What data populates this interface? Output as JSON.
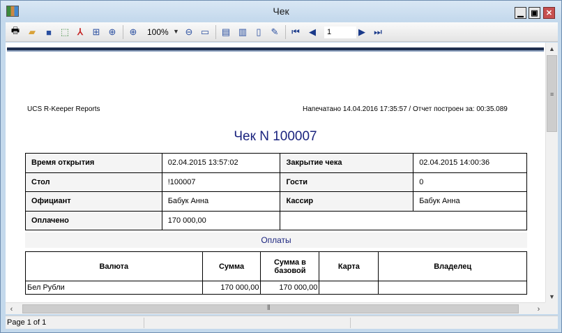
{
  "window": {
    "title": "Чек"
  },
  "toolbar": {
    "zoom": "100%",
    "page_number": "1"
  },
  "icons": [
    "app-icon",
    "print-icon",
    "open-icon",
    "save-icon",
    "export-icon",
    "pdf-icon",
    "send-icon",
    "find-icon",
    "zoom-in-icon",
    "zoom-out-icon",
    "fit-page-icon",
    "single-page-icon",
    "two-page-icon",
    "book-icon",
    "edit-icon",
    "first-page-icon",
    "prev-page-icon",
    "next-page-icon",
    "last-page-icon"
  ],
  "report": {
    "header_left": "UCS R-Keeper Reports",
    "header_right": "Напечатано 14.04.2016  17:35:57 / Отчет построен за: 00:35.089",
    "title": "Чек N 100007",
    "info": {
      "open_time_label": "Время открытия",
      "open_time_value": "02.04.2015 13:57:02",
      "close_label": "Закрытие чека",
      "close_value": "02.04.2015 14:00:36",
      "table_label": "Стол",
      "table_value": "!100007",
      "guests_label": "Гости",
      "guests_value": "0",
      "waiter_label": "Официант",
      "waiter_value": "Бабук Анна",
      "cashier_label": "Кассир",
      "cashier_value": "Бабук Анна",
      "paid_label": "Оплачено",
      "paid_value": "170 000,00"
    },
    "payments": {
      "title": "Оплаты",
      "columns": [
        "Валюта",
        "Сумма",
        "Сумма в базовой",
        "Карта",
        "Владелец"
      ],
      "rows": [
        {
          "currency": "Бел Рубли",
          "amount": "170 000,00",
          "base_amount": "170 000,00",
          "card": "",
          "owner": ""
        }
      ]
    }
  },
  "status": {
    "page_text": "Page 1 of 1"
  }
}
